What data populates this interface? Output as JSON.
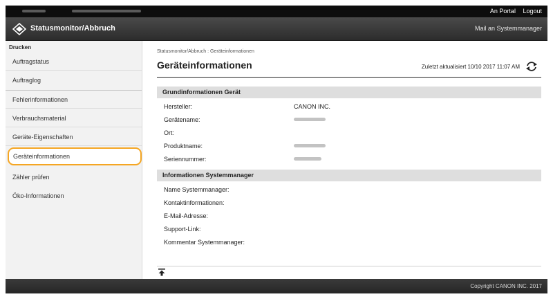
{
  "topbar": {
    "portal_link": "An Portal",
    "logout_link": "Logout"
  },
  "header": {
    "title": "Statusmonitor/Abbruch",
    "mail_link": "Mail an Systemmanager",
    "logo_icon": "diamond-logo-icon"
  },
  "sidebar": {
    "heading": "Drucken",
    "items": [
      {
        "label": "Auftragstatus"
      },
      {
        "label": "Auftraglog"
      },
      {
        "label": "Fehlerinformationen"
      },
      {
        "label": "Verbrauchsmaterial"
      },
      {
        "label": "Geräte-Eigenschaften"
      },
      {
        "label": "Geräteinformationen"
      },
      {
        "label": "Zähler prüfen"
      },
      {
        "label": "Öko-Informationen"
      }
    ],
    "active_index": 5,
    "highlight_color": "#f5a623"
  },
  "main": {
    "breadcrumb": "Statusmonitor/Abbruch : Geräteinformationen",
    "title": "Geräteinformationen",
    "last_update": "Zuletzt aktualisiert 10/10 2017 11:07 AM",
    "refresh_icon": "refresh-icon",
    "section_basic": {
      "heading": "Grundinformationen Gerät",
      "rows": [
        {
          "label": "Hersteller:",
          "value": "CANON INC."
        },
        {
          "label": "Gerätename:",
          "value": ""
        },
        {
          "label": "Ort:",
          "value": ""
        },
        {
          "label": "Produktname:",
          "value": ""
        },
        {
          "label": "Seriennummer:",
          "value": ""
        }
      ]
    },
    "section_admin": {
      "heading": "Informationen Systemmanager",
      "rows": [
        {
          "label": "Name Systemmanager:"
        },
        {
          "label": "Kontaktinformationen:"
        },
        {
          "label": "E-Mail-Adresse:"
        },
        {
          "label": "Support-Link:"
        },
        {
          "label": "Kommentar Systemmanager:"
        }
      ]
    },
    "to_top_icon": "back-to-top-icon"
  },
  "footer": {
    "copyright": "Copyright CANON INC. 2017"
  }
}
